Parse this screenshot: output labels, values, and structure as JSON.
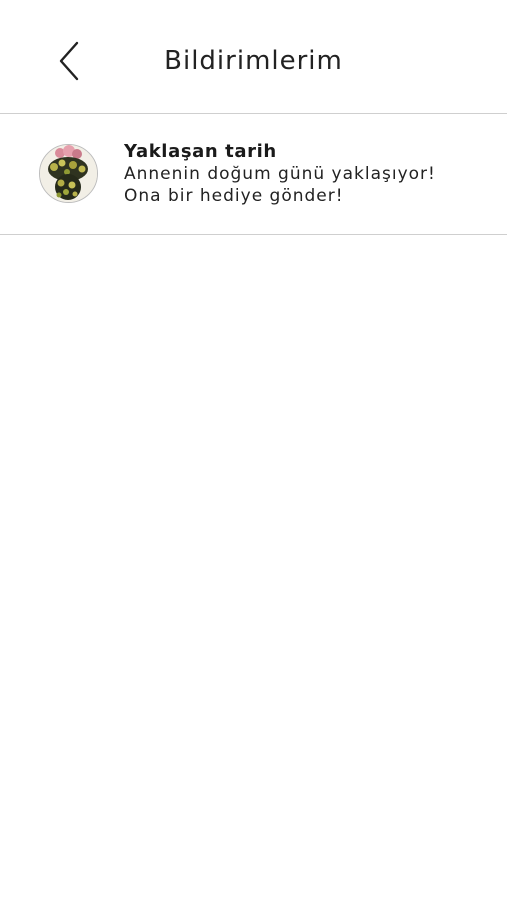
{
  "header": {
    "title": "Bildirimlerim",
    "back_icon": "chevron-left-icon"
  },
  "notifications": [
    {
      "title": "Yaklaşan tarih",
      "line1": "Annenin doğum günü yaklaşıyor!",
      "line2": "Ona bir hediye gönder!",
      "avatar_icon": "flower-bouquet-image"
    }
  ],
  "colors": {
    "text": "#1a1a1a",
    "divider": "#cfcfcf",
    "background": "#ffffff"
  }
}
